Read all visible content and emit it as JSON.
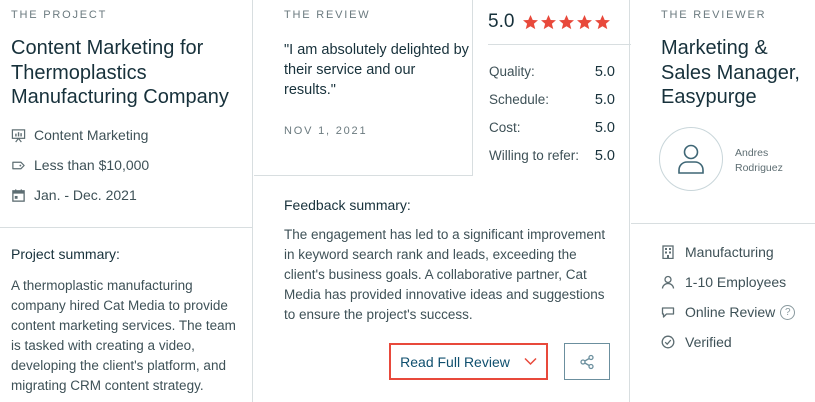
{
  "project": {
    "eyebrow": "THE PROJECT",
    "title": "Content Marketing for Thermoplastics Manufacturing Company",
    "meta": [
      {
        "icon": "presentation-board-icon",
        "text": "Content Marketing"
      },
      {
        "icon": "price-tag-icon",
        "text": "Less than $10,000"
      },
      {
        "icon": "calendar-icon",
        "text": "Jan. - Dec. 2021"
      }
    ],
    "summary_label": "Project summary:",
    "summary": "A thermoplastic manufacturing company hired Cat Media to provide content marketing services. The team is tasked with creating a video, developing the client's platform, and migrating CRM content strategy."
  },
  "review": {
    "eyebrow": "THE REVIEW",
    "quote": "\"I am absolutely delighted by their service and our results.\"",
    "date": "NOV 1, 2021",
    "overall": "5.0",
    "star_count": 5,
    "star_color": "#e8493b",
    "scores": [
      {
        "label": "Quality:",
        "value": "5.0"
      },
      {
        "label": "Schedule:",
        "value": "5.0"
      },
      {
        "label": "Cost:",
        "value": "5.0"
      },
      {
        "label": "Willing to refer:",
        "value": "5.0"
      }
    ],
    "feedback_label": "Feedback summary:",
    "feedback": "The engagement has led to a significant improvement in keyword search rank and leads, exceeding the client's business goals. A collaborative partner, Cat Media has provided innovative ideas and suggestions to ensure the project's success.",
    "read_full_label": "Read Full Review",
    "accent_color": "#e8493b"
  },
  "reviewer": {
    "eyebrow": "THE REVIEWER",
    "title": "Marketing & Sales Manager, Easypurge",
    "name": "Andres Rodriguez",
    "info": [
      {
        "icon": "building-icon",
        "text": "Manufacturing"
      },
      {
        "icon": "user-icon",
        "text": "1-10 Employees"
      },
      {
        "icon": "chat-bubble-icon",
        "text": "Online Review"
      },
      {
        "icon": "check-circle-icon",
        "text": "Verified"
      }
    ],
    "help_glyph": "?"
  }
}
